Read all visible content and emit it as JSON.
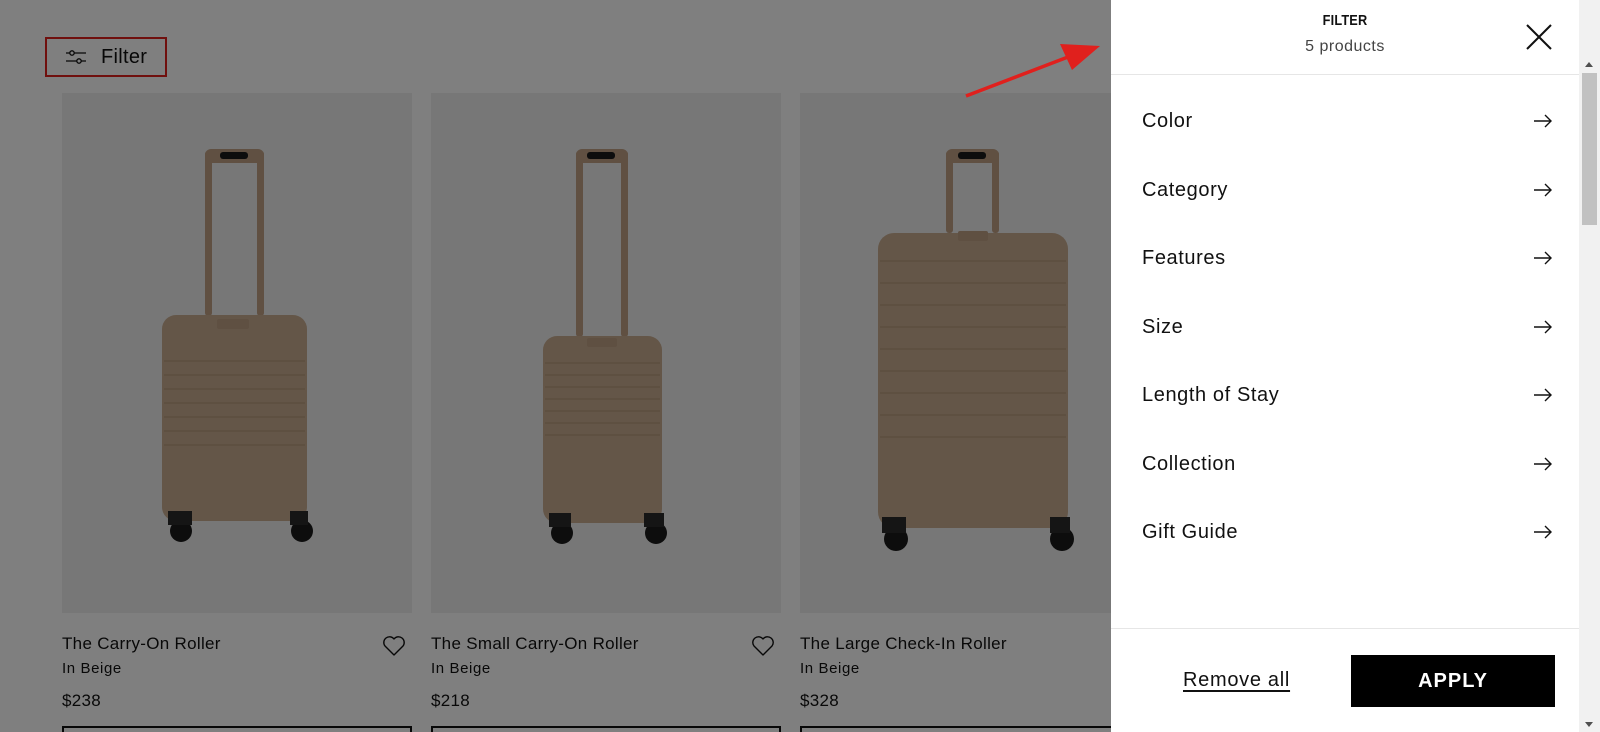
{
  "page": {
    "filter_button_label": "Filter",
    "products": [
      {
        "name": "The Carry-On Roller",
        "color": "In Beige",
        "price": "$238"
      },
      {
        "name": "The Small Carry-On Roller",
        "color": "In Beige",
        "price": "$218"
      },
      {
        "name": "The Large Check-In Roller",
        "color": "In Beige",
        "price": "$328"
      }
    ]
  },
  "drawer": {
    "title": "FILTER",
    "count": "5 products",
    "options": [
      {
        "label": "Color"
      },
      {
        "label": "Category"
      },
      {
        "label": "Features"
      },
      {
        "label": "Size"
      },
      {
        "label": "Length of Stay"
      },
      {
        "label": "Collection"
      },
      {
        "label": "Gift Guide"
      }
    ],
    "remove_all_label": "Remove all",
    "apply_label": "APPLY"
  },
  "colors": {
    "overlay": "#808080",
    "accent_red": "#e0201d",
    "apply_bg": "#000000",
    "suitcase": "#c9ad90"
  },
  "icons": {
    "filter": "sliders-icon",
    "close": "close-icon",
    "option_arrow": "arrow-right-icon",
    "wishlist": "heart-icon"
  }
}
